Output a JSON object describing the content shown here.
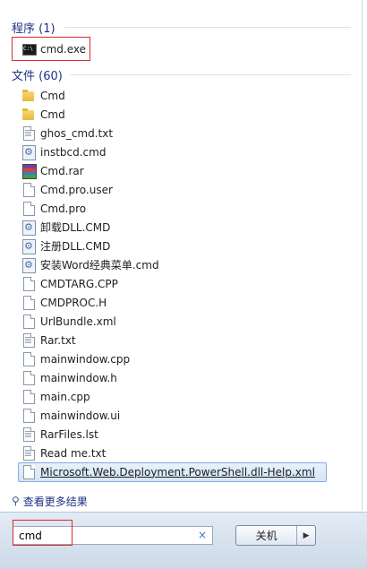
{
  "programs": {
    "header": "程序 (1)",
    "items": [
      {
        "label": "cmd.exe",
        "icon": "cmd-icon"
      }
    ]
  },
  "files": {
    "header": "文件 (60)",
    "items": [
      {
        "label": "Cmd",
        "icon": "folder-icon"
      },
      {
        "label": "Cmd",
        "icon": "folder-icon"
      },
      {
        "label": "ghos_cmd.txt",
        "icon": "text-file-icon"
      },
      {
        "label": "instbcd.cmd",
        "icon": "script-file-icon"
      },
      {
        "label": "Cmd.rar",
        "icon": "rar-archive-icon"
      },
      {
        "label": "Cmd.pro.user",
        "icon": "blank-file-icon"
      },
      {
        "label": "Cmd.pro",
        "icon": "blank-file-icon"
      },
      {
        "label": "卸载DLL.CMD",
        "icon": "script-file-icon"
      },
      {
        "label": "注册DLL.CMD",
        "icon": "script-file-icon"
      },
      {
        "label": "安装Word经典菜单.cmd",
        "icon": "script-file-icon"
      },
      {
        "label": "CMDTARG.CPP",
        "icon": "blank-file-icon"
      },
      {
        "label": "CMDPROC.H",
        "icon": "blank-file-icon"
      },
      {
        "label": "UrlBundle.xml",
        "icon": "blank-file-icon"
      },
      {
        "label": "Rar.txt",
        "icon": "text-file-icon"
      },
      {
        "label": "mainwindow.cpp",
        "icon": "blank-file-icon"
      },
      {
        "label": "mainwindow.h",
        "icon": "blank-file-icon"
      },
      {
        "label": "main.cpp",
        "icon": "blank-file-icon"
      },
      {
        "label": "mainwindow.ui",
        "icon": "blank-file-icon"
      },
      {
        "label": "RarFiles.lst",
        "icon": "text-file-icon"
      },
      {
        "label": "Read me.txt",
        "icon": "text-file-icon"
      },
      {
        "label": "Microsoft.Web.Deployment.PowerShell.dll-Help.xml",
        "icon": "blank-file-icon",
        "selected": true
      }
    ]
  },
  "see_more": {
    "label": "查看更多结果"
  },
  "search": {
    "value": "cmd",
    "clear_glyph": "×"
  },
  "shutdown": {
    "label": "关机",
    "arrow_glyph": "▶"
  },
  "colors": {
    "highlight_box": "#e0282d",
    "header_text": "#1e3287",
    "selection_border": "#84acdd"
  }
}
